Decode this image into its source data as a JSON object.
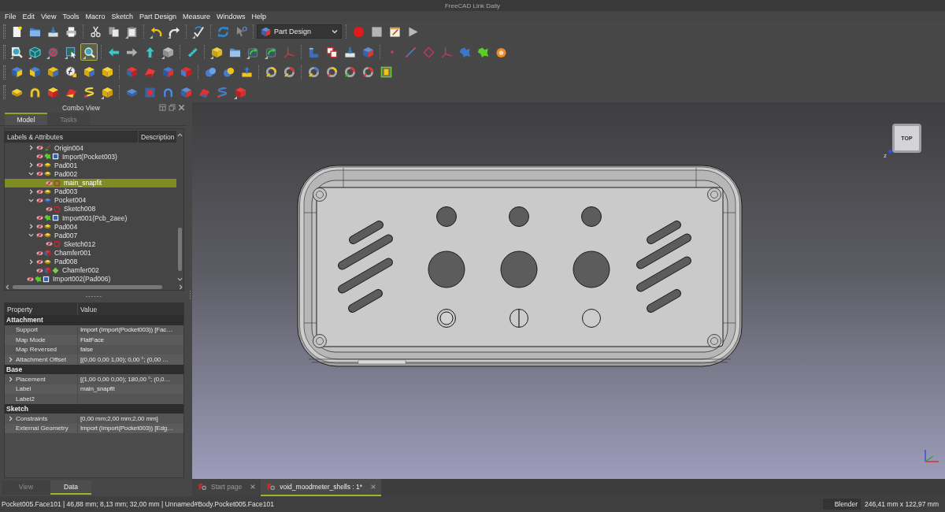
{
  "window": {
    "title": "FreeCAD Link Daily"
  },
  "menu": [
    "File",
    "Edit",
    "View",
    "Tools",
    "Macro",
    "Sketch",
    "Part Design",
    "Measure",
    "Windows",
    "Help"
  ],
  "toolbars": [
    {
      "groups": [
        {
          "kind": "buttons",
          "buttons": [
            {
              "highlighted": false
            },
            {
              "highlighted": false
            },
            {
              "highlighted": false
            },
            {
              "highlighted": false
            }
          ]
        },
        {
          "kind": "buttons",
          "buttons": [
            {
              "highlighted": false
            },
            {
              "highlighted": false
            },
            {
              "highlighted": false
            }
          ]
        },
        {
          "kind": "buttons",
          "buttons": [
            {
              "highlighted": false
            },
            {
              "highlighted": false
            }
          ]
        },
        {
          "kind": "buttons",
          "buttons": [
            {
              "highlighted": false
            }
          ]
        },
        {
          "kind": "buttons",
          "buttons": [
            {
              "highlighted": false
            },
            {
              "highlighted": false
            }
          ]
        },
        {
          "kind": "dropdown",
          "value": "Part Design"
        },
        {
          "kind": "buttons",
          "buttons": [
            {
              "highlighted": false
            },
            {
              "highlighted": false
            },
            {
              "highlighted": false
            },
            {
              "highlighted": false
            }
          ]
        }
      ]
    },
    {
      "groups": [
        {
          "kind": "buttons",
          "buttons": [
            {
              "highlighted": false
            },
            {
              "highlighted": false
            },
            {
              "highlighted": false
            },
            {
              "highlighted": false
            },
            {
              "highlighted": true
            }
          ]
        },
        {
          "kind": "buttons",
          "buttons": [
            {
              "highlighted": false
            },
            {
              "highlighted": false
            },
            {
              "highlighted": false
            },
            {
              "highlighted": false
            }
          ]
        },
        {
          "kind": "buttons",
          "buttons": [
            {
              "highlighted": false
            }
          ]
        },
        {
          "kind": "buttons",
          "buttons": [
            {
              "highlighted": false
            },
            {
              "highlighted": false
            },
            {
              "highlighted": false
            },
            {
              "highlighted": false
            },
            {
              "highlighted": false
            }
          ]
        },
        {
          "kind": "buttons",
          "buttons": [
            {
              "highlighted": false
            },
            {
              "highlighted": false
            },
            {
              "highlighted": false
            },
            {
              "highlighted": false
            }
          ]
        },
        {
          "kind": "buttons",
          "buttons": [
            {
              "highlighted": false
            },
            {
              "highlighted": false
            },
            {
              "highlighted": false
            },
            {
              "highlighted": false
            },
            {
              "highlighted": false
            },
            {
              "highlighted": false
            },
            {
              "highlighted": false
            }
          ]
        }
      ]
    },
    {
      "groups": [
        {
          "kind": "buttons",
          "buttons": [
            {
              "highlighted": false
            },
            {
              "highlighted": false
            },
            {
              "highlighted": false
            },
            {
              "highlighted": false
            },
            {
              "highlighted": false
            },
            {
              "highlighted": false
            }
          ]
        },
        {
          "kind": "buttons",
          "buttons": [
            {
              "highlighted": false
            },
            {
              "highlighted": false
            },
            {
              "highlighted": false
            },
            {
              "highlighted": false
            }
          ]
        },
        {
          "kind": "buttons",
          "buttons": [
            {
              "highlighted": false
            },
            {
              "highlighted": false
            },
            {
              "highlighted": false
            }
          ]
        },
        {
          "kind": "buttons",
          "buttons": [
            {
              "highlighted": false
            },
            {
              "highlighted": false
            }
          ]
        },
        {
          "kind": "buttons",
          "buttons": [
            {
              "highlighted": false
            },
            {
              "highlighted": false
            },
            {
              "highlighted": false
            },
            {
              "highlighted": false
            },
            {
              "highlighted": false
            }
          ]
        }
      ]
    },
    {
      "groups": [
        {
          "kind": "buttons",
          "buttons": [
            {
              "highlighted": false
            },
            {
              "highlighted": false
            },
            {
              "highlighted": false
            },
            {
              "highlighted": false
            },
            {
              "highlighted": false
            },
            {
              "highlighted": false
            }
          ]
        },
        {
          "kind": "buttons",
          "buttons": [
            {
              "highlighted": false
            },
            {
              "highlighted": false
            },
            {
              "highlighted": false
            },
            {
              "highlighted": false
            },
            {
              "highlighted": false
            },
            {
              "highlighted": false
            },
            {
              "highlighted": false
            }
          ]
        }
      ]
    }
  ],
  "combo_view": {
    "title": "Combo View",
    "tabs": [
      {
        "label": "Model",
        "selected": true
      },
      {
        "label": "Tasks",
        "selected": false
      }
    ],
    "tree": {
      "columns": [
        "Labels & Attributes",
        "Description"
      ],
      "items": [
        {
          "children": [
            {
              "label": "Origin004",
              "kind": "origin",
              "expanded": false,
              "selected": false,
              "tip": false
            },
            {
              "label": "Import(Pocket003)",
              "kind": "import",
              "selected": false,
              "tip": false
            },
            {
              "label": "Pad001",
              "kind": "pad",
              "expanded": false,
              "selected": false,
              "tip": false
            },
            {
              "label": "Pad002",
              "kind": "pad",
              "expanded": true,
              "selected": false,
              "tip": false,
              "children": [
                {
                  "label": "main_snapfit",
                  "kind": "sketch",
                  "selected": true,
                  "tip": false
                }
              ]
            },
            {
              "label": "Pad003",
              "kind": "pad",
              "expanded": false,
              "selected": false,
              "tip": false
            },
            {
              "label": "Pocket004",
              "kind": "pocket",
              "expanded": true,
              "selected": false,
              "tip": false,
              "children": [
                {
                  "label": "Sketch008",
                  "kind": "sketch",
                  "selected": false,
                  "tip": false
                }
              ]
            },
            {
              "label": "Import001(Pcb_2aee)",
              "kind": "import",
              "selected": false,
              "tip": false
            },
            {
              "label": "Pad004",
              "kind": "pad",
              "expanded": false,
              "selected": false,
              "tip": false
            },
            {
              "label": "Pad007",
              "kind": "pad",
              "expanded": true,
              "selected": false,
              "tip": false,
              "children": [
                {
                  "label": "Sketch012",
                  "kind": "sketch",
                  "selected": false,
                  "tip": false
                }
              ]
            },
            {
              "label": "Chamfer001",
              "kind": "chamfer",
              "selected": false,
              "tip": false
            },
            {
              "label": "Pad008",
              "kind": "pad",
              "expanded": false,
              "selected": false,
              "tip": false
            },
            {
              "label": "Chamfer002",
              "kind": "chamfer",
              "selected": false,
              "tip": true
            }
          ]
        },
        {
          "label": "Import002(Pad006)",
          "kind": "import",
          "selected": false,
          "tip": false
        }
      ]
    }
  },
  "property_view": {
    "columns": [
      "Property",
      "Value"
    ],
    "groups": [
      {
        "name": "Attachment",
        "rows": [
          {
            "name": "Support",
            "value": "Import (Import(Pocket003)) [Fac…"
          },
          {
            "name": "Map Mode",
            "value": "FlatFace"
          },
          {
            "name": "Map Reversed",
            "value": "false"
          },
          {
            "name": "Attachment Offset",
            "value": "[(0,00 0,00 1,00); 0,00 °; (0,00 …",
            "expanded": false
          }
        ]
      },
      {
        "name": "Base",
        "rows": [
          {
            "name": "Placement",
            "value": "[(1,00 0,00 0,00); 180,00 °; (0,0…",
            "expanded": false
          },
          {
            "name": "Label",
            "value": "main_snapfit"
          },
          {
            "name": "Label2"
          }
        ]
      },
      {
        "name": "Sketch",
        "rows": [
          {
            "name": "Constraints",
            "value": "[0,00 mm;2,00 mm;2,00 mm]",
            "expanded": false
          },
          {
            "name": "External Geometry",
            "value": "Import (Import(Pocket003)) [Edg…"
          }
        ]
      }
    ],
    "tabs": [
      {
        "label": "View",
        "selected": false
      },
      {
        "label": "Data",
        "selected": true
      }
    ]
  },
  "view_3d": {
    "nav_cube": {
      "face": "TOP",
      "axis": "z"
    }
  },
  "document_tabs": [
    {
      "label": "Start page",
      "selected": false
    },
    {
      "label": "void_moodmeter_shells : 1*",
      "selected": true
    }
  ],
  "status_bar": {
    "message": "Pocket005.Face101 | 46,88 mm; 8,13 mm; 32,00 mm | Unnamed#Body.Pocket005.Face101",
    "navigation": "Blender",
    "dimensions": "246,41 mm x 122,97 mm"
  }
}
